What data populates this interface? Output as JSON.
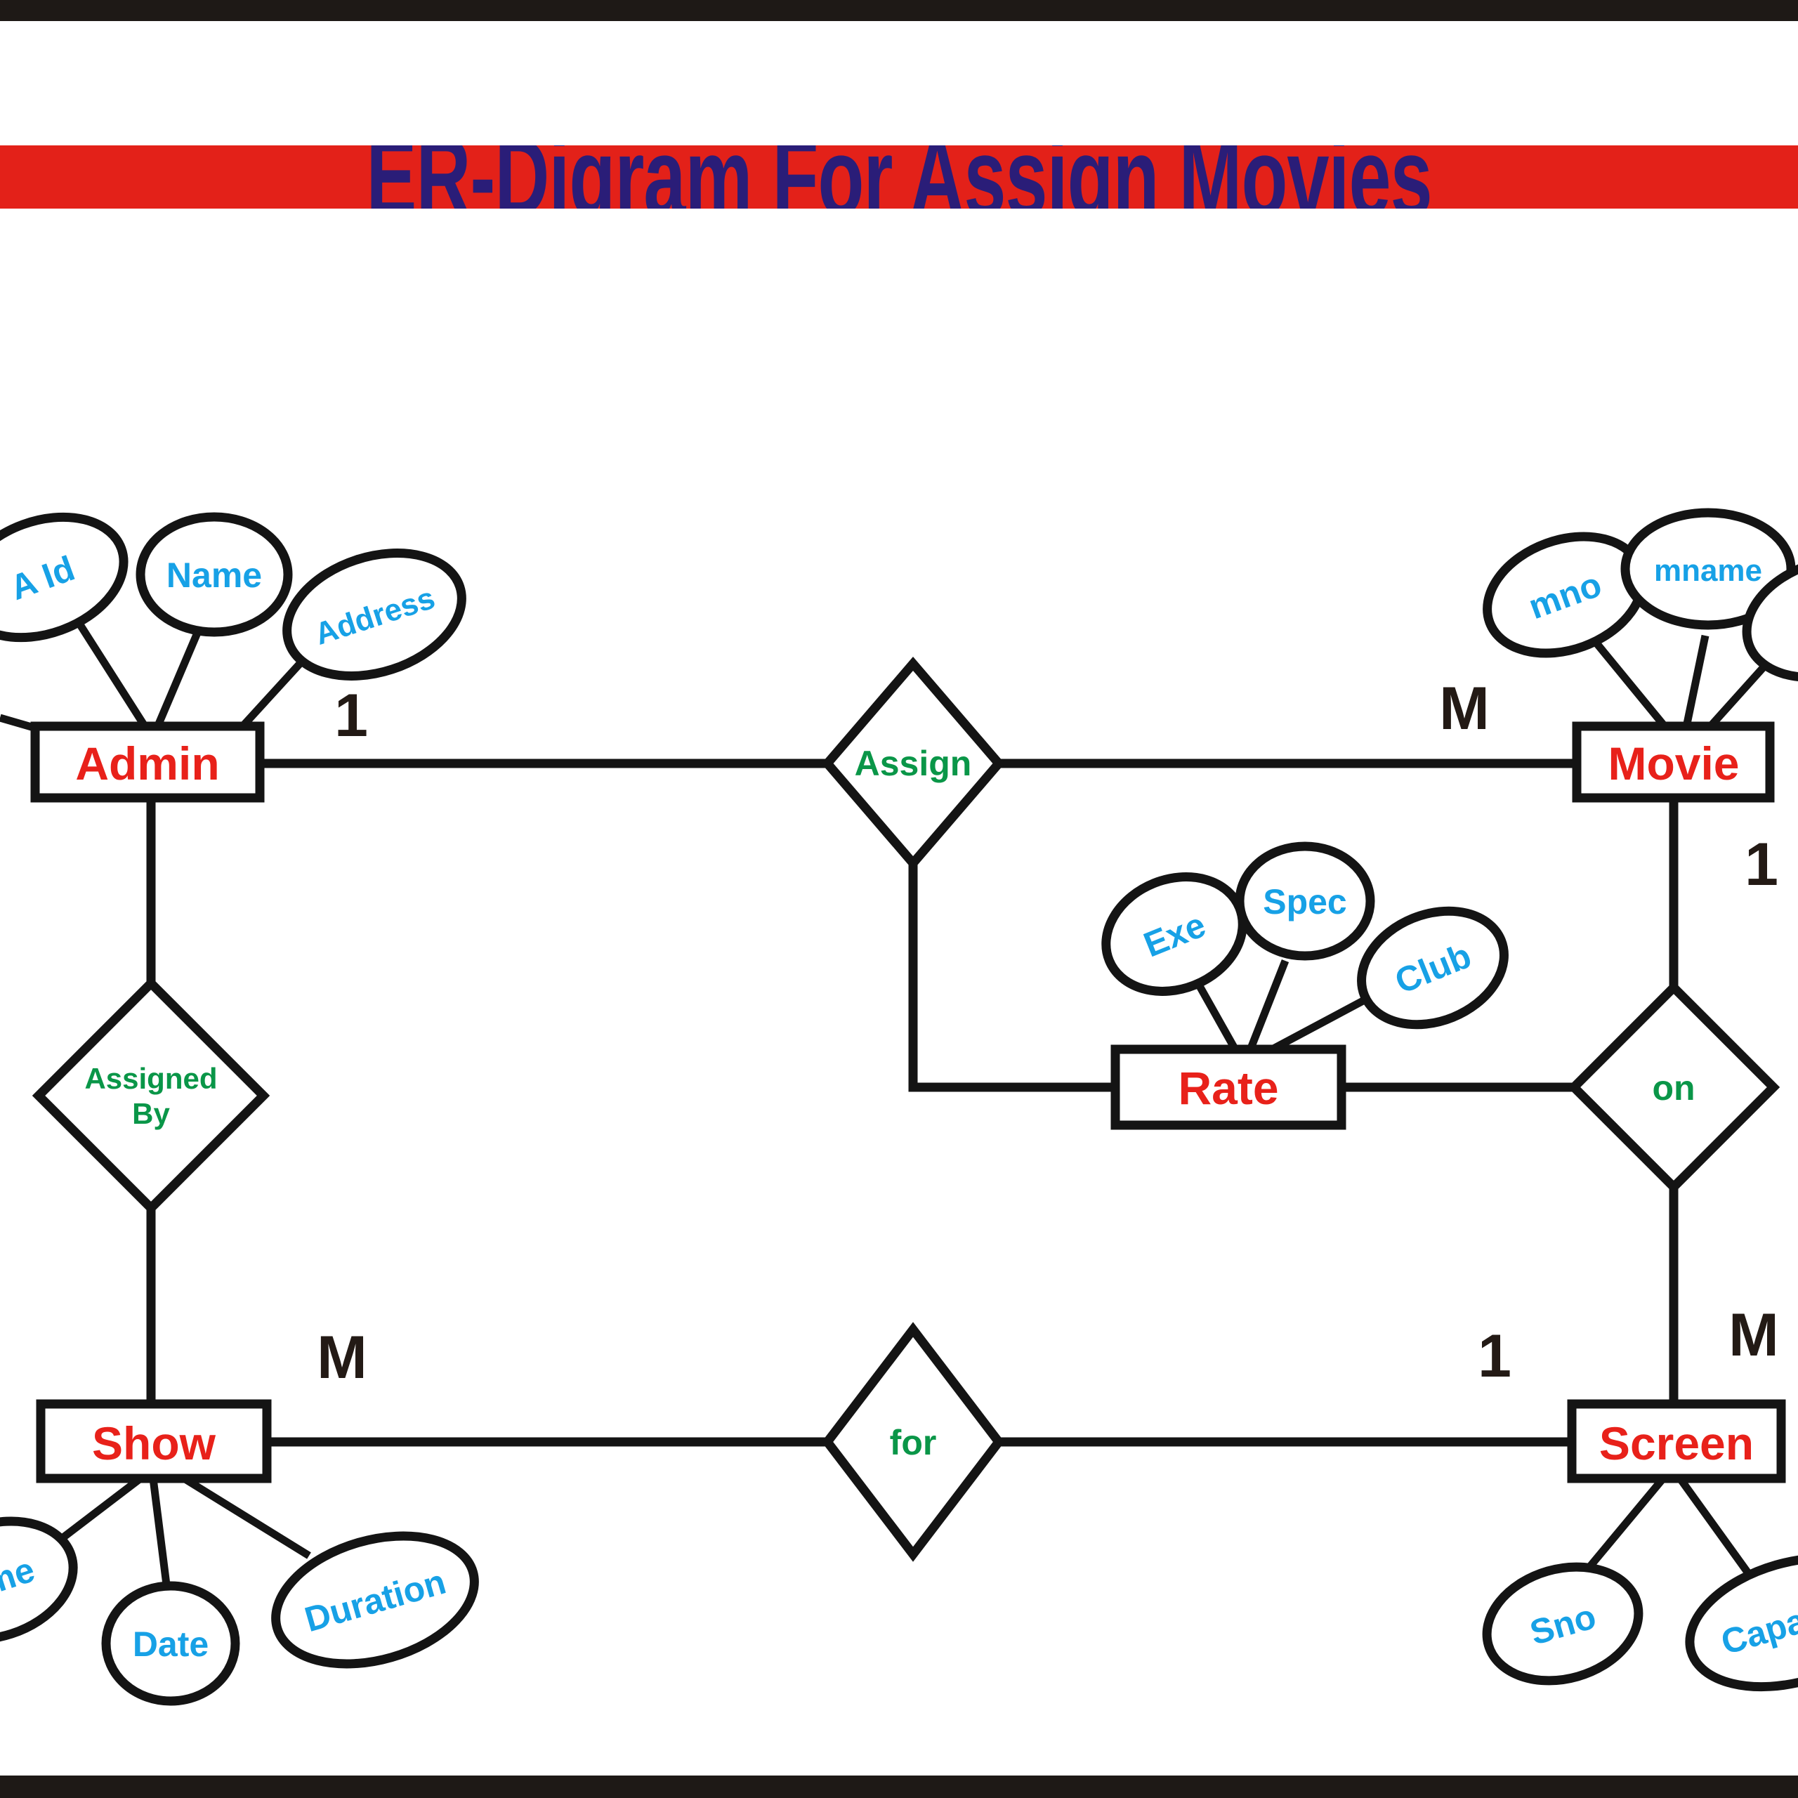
{
  "frame": {
    "top_bar_color": "#1e1916",
    "bottom_bar_color": "#1e1916"
  },
  "banner": {
    "title": "ER-Digram For Assign Movies",
    "background_color": "#e32119",
    "text_color": "#2a1d78"
  },
  "palette": {
    "entity_text": "#e8211a",
    "relationship_text": "#0a9648",
    "attribute_text": "#17a1e6",
    "cardinality_text": "#231a15",
    "line": "#141414"
  },
  "diagram": {
    "entities": [
      {
        "id": "admin",
        "label": "Admin"
      },
      {
        "id": "movie",
        "label": "Movie"
      },
      {
        "id": "rate",
        "label": "Rate"
      },
      {
        "id": "show",
        "label": "Show"
      },
      {
        "id": "screen",
        "label": "Screen"
      }
    ],
    "relationships": [
      {
        "id": "assign",
        "label": "Assign"
      },
      {
        "id": "assigned-by",
        "label_line1": "Assigned",
        "label_line2": "By"
      },
      {
        "id": "on",
        "label": "on"
      },
      {
        "id": "for",
        "label": "for"
      }
    ],
    "attributes": [
      {
        "id": "a-id",
        "owner": "admin",
        "label": "A Id"
      },
      {
        "id": "name",
        "owner": "admin",
        "label": "Name"
      },
      {
        "id": "address",
        "owner": "admin",
        "label": "Address"
      },
      {
        "id": "mno",
        "owner": "movie",
        "label": "mno"
      },
      {
        "id": "mname",
        "owner": "movie",
        "label": "mname"
      },
      {
        "id": "exe",
        "owner": "rate",
        "label": "Exe"
      },
      {
        "id": "spec",
        "owner": "rate",
        "label": "Spec"
      },
      {
        "id": "club",
        "owner": "rate",
        "label": "Club"
      },
      {
        "id": "time",
        "owner": "show",
        "label": "Time"
      },
      {
        "id": "date",
        "owner": "show",
        "label": "Date"
      },
      {
        "id": "duration",
        "owner": "show",
        "label": "Duration"
      },
      {
        "id": "sno",
        "owner": "screen",
        "label": "Sno"
      },
      {
        "id": "capacity",
        "owner": "screen",
        "label": "Capacity"
      }
    ],
    "cardinalities": [
      {
        "id": "admin-assign",
        "label": "1"
      },
      {
        "id": "assign-movie",
        "label": "M"
      },
      {
        "id": "movie-on",
        "label": "1"
      },
      {
        "id": "on-screen",
        "label": "M"
      },
      {
        "id": "show-for",
        "label": "M"
      },
      {
        "id": "for-screen",
        "label": "1"
      }
    ]
  }
}
